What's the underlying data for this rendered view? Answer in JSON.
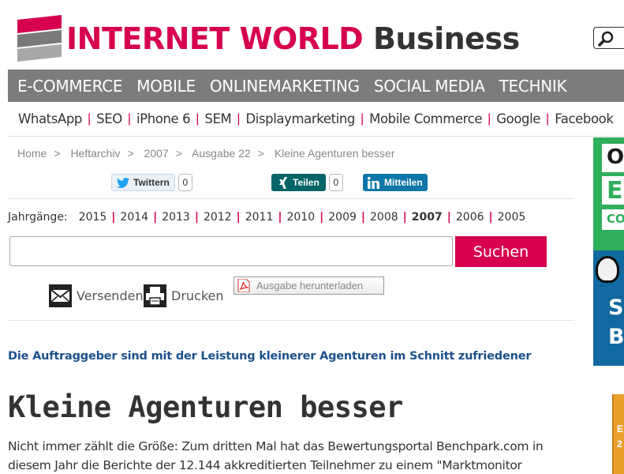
{
  "logo": {
    "part1": "INTERNET WORLD",
    "part2": "Business"
  },
  "main_nav": [
    "E-COMMERCE",
    "MOBILE",
    "ONLINEMARKETING",
    "SOCIAL MEDIA",
    "TECHNIK"
  ],
  "sub_nav": [
    "WhatsApp",
    "SEO",
    "iPhone 6",
    "SEM",
    "Displaymarketing",
    "Mobile Commerce",
    "Google",
    "Facebook"
  ],
  "breadcrumb": [
    "Home",
    "Heftarchiv",
    "2007",
    "Ausgabe 22",
    "Kleine Agenturen besser"
  ],
  "share": {
    "twitter_label": "Twittern",
    "twitter_count": "0",
    "xing_label": "Teilen",
    "xing_count": "0",
    "linkedin_label": "Mitteilen"
  },
  "years": {
    "label": "Jahrgänge:",
    "items": [
      "2015",
      "2014",
      "2013",
      "2012",
      "2011",
      "2010",
      "2009",
      "2008",
      "2007",
      "2006",
      "2005"
    ],
    "active": "2007"
  },
  "search": {
    "value": "",
    "placeholder": "",
    "button": "Suchen"
  },
  "tools": {
    "send": "Versenden",
    "print": "Drucken",
    "pdf": "Ausgabe herunterladen"
  },
  "article": {
    "teaser": "Die Auftraggeber sind mit der Leistung kleinerer Agenturen im Schnitt zufriedener",
    "headline": "Kleine Agenturen besser",
    "body": "Nicht immer zählt die Größe: Zum dritten Mal hat das Bewertungsportal Benchpark.com in diesem Jahr die Berichte der 12.144 akkreditierten Teilnehmer zu einem \"Marktmonitor"
  },
  "ad": {
    "line1": "O",
    "line2": "E",
    "line3": "CO",
    "line4": "S",
    "line5": "B",
    "book1": "E",
    "book2": "2"
  },
  "colors": {
    "brand": "#d6004e",
    "nav_bg": "#7c7c7c",
    "teaser": "#1d4f8c"
  }
}
